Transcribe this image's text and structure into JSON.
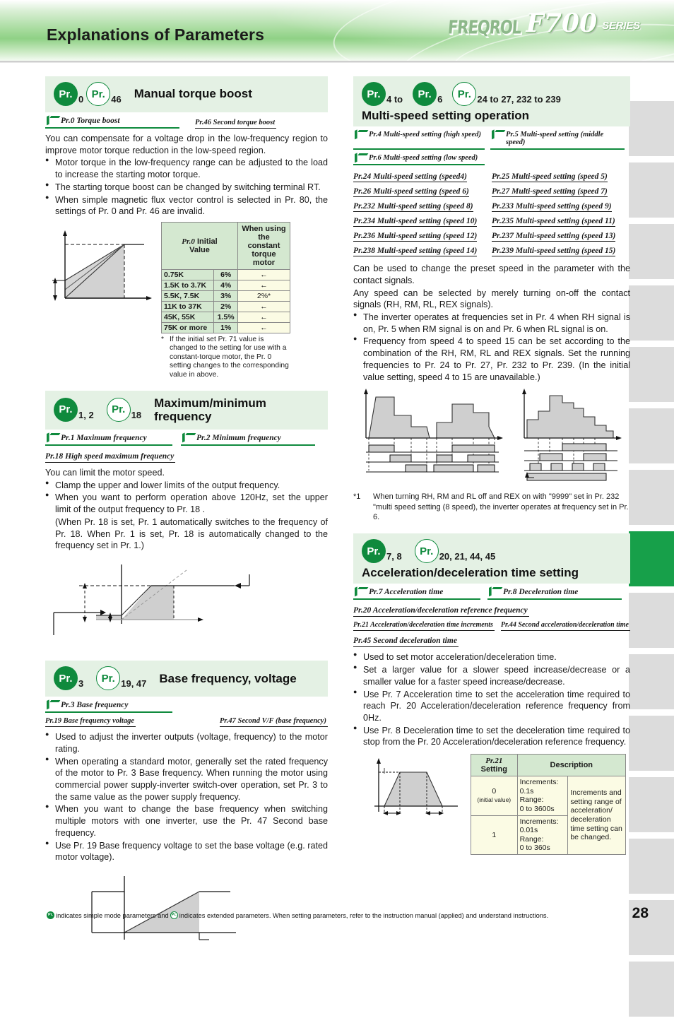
{
  "header": {
    "title": "Explanations of Parameters",
    "logo_brand": "FREQROL",
    "logo_model": "F700",
    "logo_series": "SERIES"
  },
  "side_tabs": {
    "count": 15,
    "active_index": 8,
    "active_color": "#17a04a",
    "inactive_color": "#dcdcdc"
  },
  "sections": {
    "manual_torque_boost": {
      "badges": [
        {
          "style": "filled",
          "label": "Pr.",
          "num": "0"
        },
        {
          "style": "outline",
          "label": "Pr.",
          "num": "46"
        }
      ],
      "title": "Manual torque boost",
      "params_simple": [
        "Pr.0 Torque boost"
      ],
      "params_ext": [
        "Pr.46 Second torque boost"
      ],
      "intro": "You can compensate for a voltage drop in the low-frequency region to improve motor torque reduction in the low-speed region.",
      "bullets": [
        "Motor torque in the low-frequency range can be adjusted to the load to increase the starting motor torque.",
        "The starting torque boost can be changed by switching terminal RT.",
        "When simple magnetic flux vector control is selected in Pr. 80, the settings of Pr. 0 and Pr. 46  are invalid."
      ],
      "table": {
        "headers": [
          "Pr.0 Initial Value",
          "When using the constant torque motor"
        ],
        "rows": [
          {
            "capacity": "0.75K",
            "value": "6%",
            "constant": "←"
          },
          {
            "capacity": "1.5K to 3.7K",
            "value": "4%",
            "constant": "←"
          },
          {
            "capacity": "5.5K, 7.5K",
            "value": "3%",
            "constant": "2%*"
          },
          {
            "capacity": "11K to 37K",
            "value": "2%",
            "constant": "←"
          },
          {
            "capacity": "45K, 55K",
            "value": "1.5%",
            "constant": "←"
          },
          {
            "capacity": "75K or more",
            "value": "1%",
            "constant": "←"
          }
        ],
        "note_mark": "*",
        "note": "If the initial set Pr. 71 value is changed to the setting for use with a constant-torque motor, the Pr. 0 setting changes to the corresponding value in above."
      }
    },
    "max_min_frequency": {
      "badges": [
        {
          "style": "filled",
          "label": "Pr.",
          "num": "1, 2"
        },
        {
          "style": "outline",
          "label": "Pr.",
          "num": "18"
        }
      ],
      "title": "Maximum/minimum frequency",
      "params_simple": [
        "Pr.1 Maximum frequency",
        "Pr.2 Minimum frequency"
      ],
      "params_ext": [
        "Pr.18 High speed maximum frequency"
      ],
      "intro": "You can limit the motor speed.",
      "bullets": [
        "Clamp the upper and lower limits of the output frequency.",
        "When you want to perform operation above 120Hz, set the upper limit of the output frequency to Pr. 18 ."
      ],
      "paren": "(When Pr. 18 is set, Pr. 1 automatically switches to the frequency of Pr. 18. When Pr. 1 is set, Pr. 18 is automatically changed to the frequency set in Pr. 1.)"
    },
    "base_frequency": {
      "badges": [
        {
          "style": "filled",
          "label": "Pr.",
          "num": "3"
        },
        {
          "style": "outline",
          "label": "Pr.",
          "num": "19, 47"
        }
      ],
      "title": "Base frequency, voltage",
      "params_simple": [
        "Pr.3 Base frequency"
      ],
      "params_ext": [
        "Pr.19 Base frequency voltage",
        "Pr.47 Second V/F (base frequency)"
      ],
      "bullets": [
        "Used to adjust the inverter outputs (voltage, frequency) to the motor rating.",
        "When operating a standard motor, generally set the rated frequency of the motor to Pr. 3 Base frequency. When running the motor using commercial power supply-inverter switch-over operation, set Pr. 3 to the same value as the power supply frequency.",
        "When you want to change the base frequency when switching multiple motors with one inverter, use the Pr. 47 Second base frequency.",
        "Use Pr. 19 Base frequency voltage to set the base voltage (e.g. rated motor voltage)."
      ]
    },
    "multi_speed": {
      "badges": [
        {
          "style": "filled",
          "label": "Pr.",
          "num": "4 to"
        },
        {
          "style": "filled",
          "label": "Pr.",
          "num": "6"
        },
        {
          "style": "outline",
          "label": "Pr.",
          "num": "24 to 27, 232 to 239"
        }
      ],
      "title": "Multi-speed setting operation",
      "params_simple": [
        "Pr.4 Multi-speed setting (high speed)",
        "Pr.5 Multi-speed setting (middle speed)",
        "Pr.6 Multi-speed setting (low speed)"
      ],
      "params_ext_left": [
        "Pr.24 Multi-speed setting (speed4)",
        "Pr.26 Multi-speed setting (speed 6)",
        "Pr.232 Multi-speed setting (speed 8)",
        "Pr.234 Multi-speed setting (speed 10)",
        "Pr.236 Multi-speed setting (speed 12)",
        "Pr.238 Multi-speed setting (speed 14)"
      ],
      "params_ext_right": [
        "Pr.25 Multi-speed setting (speed 5)",
        "Pr.27 Multi-speed setting (speed 7)",
        "Pr.233 Multi-speed setting (speed 9)",
        "Pr.235 Multi-speed setting (speed 11)",
        "Pr.237 Multi-speed setting (speed 13)",
        "Pr.239 Multi-speed setting (speed 15)"
      ],
      "intro1": "Can be used to change the preset speed in the parameter with the contact signals.",
      "intro2": "Any speed can be selected by merely turning on-off the contact signals (RH, RM, RL, REX signals).",
      "bullets": [
        "The inverter operates at frequencies set in Pr. 4 when RH signal is on, Pr. 5 when RM signal is on and Pr. 6 when RL signal is on.",
        "Frequency from speed 4 to speed 15 can be set according to the combination of the RH, RM, RL and REX signals. Set the running frequencies to Pr. 24 to Pr. 27, Pr. 232 to Pr. 239. (In the initial value setting, speed 4 to 15 are unavailable.)"
      ],
      "footnote_mark": "*1",
      "footnote": "When turning RH, RM and RL off and REX on with \"9999\" set in Pr. 232 \"multi speed setting (8 speed), the inverter operates at frequency set in Pr. 6."
    },
    "accel_decel": {
      "badges": [
        {
          "style": "filled",
          "label": "Pr.",
          "num": "7, 8"
        },
        {
          "style": "outline",
          "label": "Pr.",
          "num": "20, 21, 44, 45"
        }
      ],
      "title": "Acceleration/deceleration time setting",
      "params_simple": [
        "Pr.7 Acceleration time",
        "Pr.8 Deceleration time"
      ],
      "params_ext_1": [
        "Pr.20 Acceleration/deceleration reference frequency"
      ],
      "params_ext_2": [
        "Pr.21 Acceleration/deceleration time increments",
        "Pr.44 Second acceleration/deceleration time"
      ],
      "params_ext_3": [
        "Pr.45 Second deceleration time"
      ],
      "bullets": [
        "Used to set motor acceleration/deceleration time.",
        "Set a larger value for a slower speed increase/decrease or a smaller value for a faster speed increase/decrease.",
        "Use Pr. 7 Acceleration time to set the acceleration time required to reach Pr. 20 Acceleration/deceleration reference frequency from 0Hz.",
        "Use Pr. 8 Deceleration time to set the deceleration time required to stop from the Pr. 20 Acceleration/deceleration reference frequency."
      ],
      "table": {
        "headers": [
          "Pr.21 Setting",
          "Description"
        ],
        "rows": [
          {
            "setting": "0",
            "setting_sub": "(initial value)",
            "detail": "Increments: 0.1s\nRange:\n0 to 3600s"
          },
          {
            "setting": "1",
            "setting_sub": "",
            "detail": "Increments: 0.01s\nRange:\n0 to 360s"
          }
        ],
        "description": "Increments and setting range of acceleration/ deceleration time setting can be changed."
      }
    }
  },
  "footer": {
    "text_before": "indicates simple mode parameters and",
    "text_middle": "indicates extended parameters. When setting parameters, refer to the instruction manual (applied) and understand instructions.",
    "badge_filled": "Pr.",
    "badge_outline": "Pr.",
    "page_number": "28"
  }
}
